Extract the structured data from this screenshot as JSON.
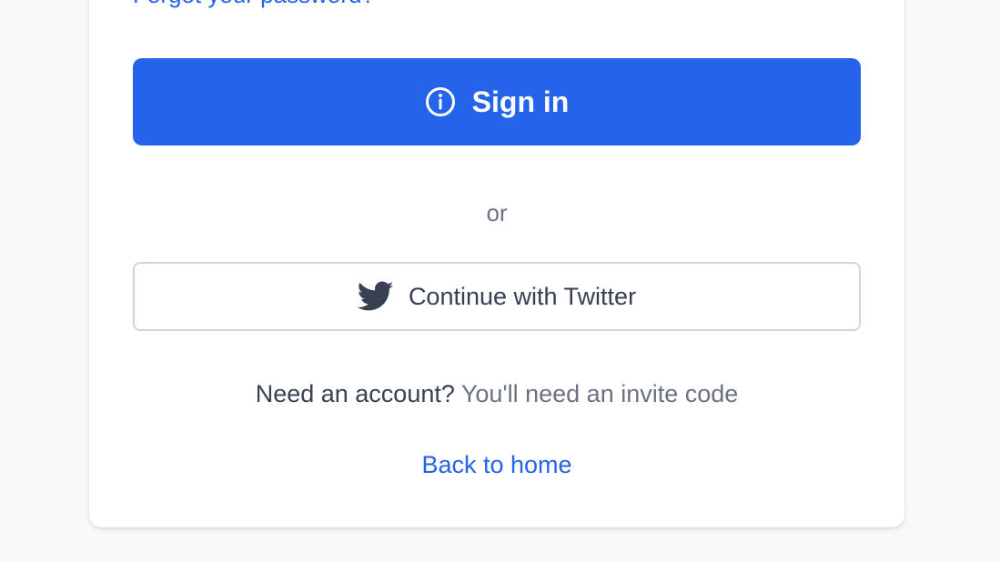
{
  "form": {
    "forgot_password_label": "Forgot your password?",
    "signin_label": "Sign in",
    "signin_icon": "info-circle-icon",
    "divider_text": "or",
    "twitter_label": "Continue with Twitter",
    "twitter_icon": "twitter-bird-icon",
    "account_question": "Need an account?",
    "account_note": "You'll need an invite code",
    "back_home_label": "Back to home"
  },
  "colors": {
    "primary": "#2563eb",
    "background": "#f8f9fb",
    "muted_text": "#6b7280",
    "dark_text": "#374151",
    "border": "#d1d5db"
  }
}
